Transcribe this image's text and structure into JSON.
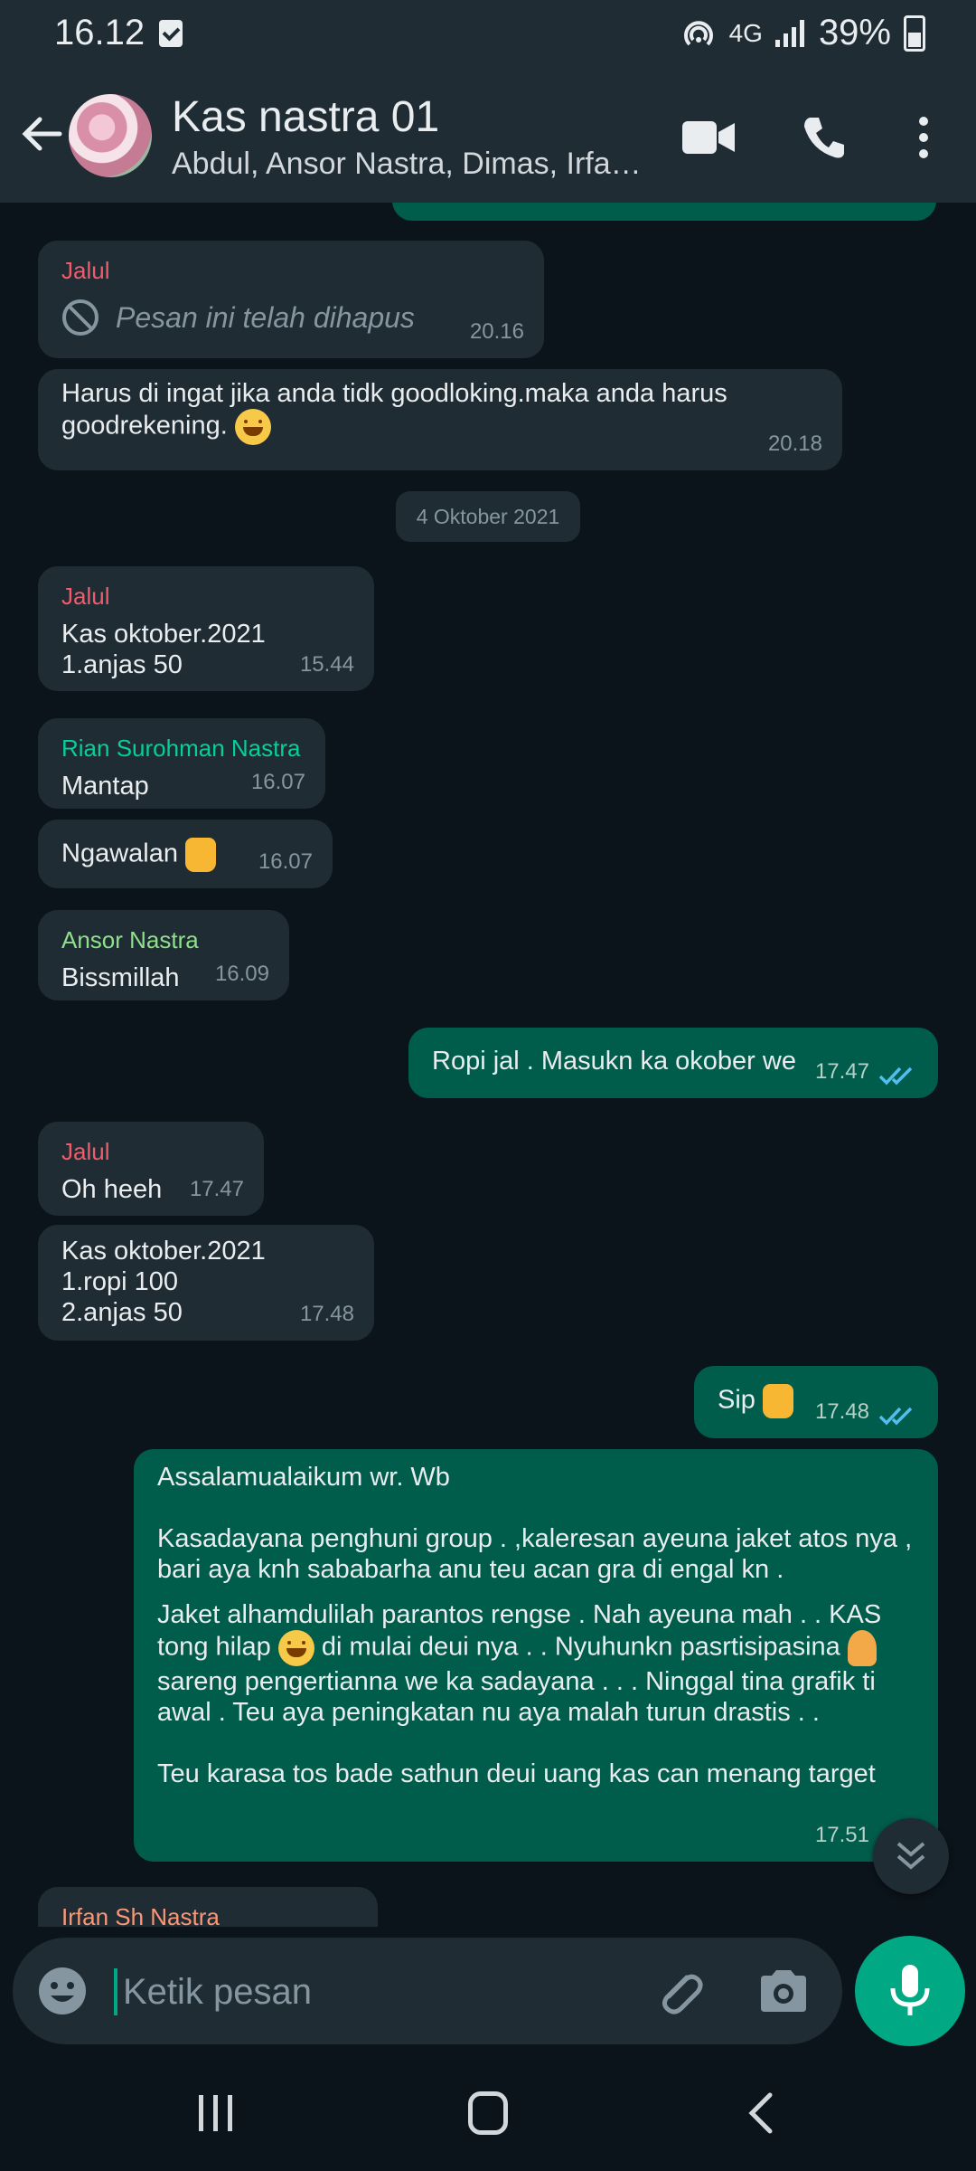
{
  "status_bar": {
    "time": "16.12",
    "network": "4G",
    "battery": "39%"
  },
  "header": {
    "title": "Kas nastra 01",
    "subtitle": "Abdul, Ansor Nastra, Dimas, Irfan..."
  },
  "colors": {
    "accent": "#00a884",
    "outgoing": "#005c4b",
    "incoming": "#202c33",
    "sender_red": "#f15c6d",
    "sender_green": "#53bdeb"
  },
  "messages": [
    {
      "sender": "Jalul",
      "sender_color": "#f15c6d",
      "deleted_text": "Pesan ini telah dihapus",
      "time": "20.16"
    },
    {
      "text": "Harus di ingat jika anda tidk goodloking.maka anda harus goodrekening.",
      "time": "20.18"
    },
    {
      "sender": "Jalul",
      "sender_color": "#f15c6d",
      "text_lines": [
        "Kas oktober.2021",
        "1.anjas 50"
      ],
      "time": "15.44"
    },
    {
      "sender": "Rian Surohman Nastra",
      "sender_color": "#06cf9c",
      "text": "Mantap",
      "time": "16.07"
    },
    {
      "text": "Ngawalan",
      "time": "16.07"
    },
    {
      "sender": "Ansor Nastra",
      "sender_color": "#8ee08a",
      "text": "Bissmillah",
      "time": "16.09"
    },
    {
      "text": "Ropi jal . Masukn ka okober we",
      "time": "17.47"
    },
    {
      "sender": "Jalul",
      "sender_color": "#f15c6d",
      "text": "Oh heeh",
      "time": "17.47"
    },
    {
      "text_lines": [
        "Kas oktober.2021",
        "1.ropi 100",
        "2.anjas 50"
      ],
      "time": "17.48"
    },
    {
      "text": "Sip",
      "time": "17.48"
    },
    {
      "paragraphs": [
        "Assalamualaikum wr. Wb",
        "Kasadayana penghuni group . ,kaleresan ayeuna jaket atos nya , bari aya knh sababarha anu teu acan gra di engal kn .",
        "Jaket alhamdulilah parantos rengse . Nah ayeuna mah . . KAS tong hilap",
        "di mulai deui nya . . Nyuhunkn pasrtisipasina",
        "sareng pengertianna we ka sadayana . . . Ninggal tina grafik ti awal . Teu aya peningkatan nu aya malah turun drastis . .",
        "Teu karasa tos bade sathun deui   uang kas can menang target"
      ],
      "time": "17.51"
    },
    {
      "sender": "Irfan Sh Nastra",
      "sender_color": "#fc9775"
    }
  ],
  "date_divider": "4 Oktober 2021",
  "input": {
    "placeholder": "Ketik pesan"
  }
}
